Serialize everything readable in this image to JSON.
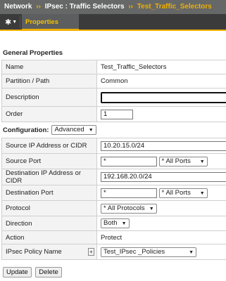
{
  "breadcrumb": {
    "items": [
      "Network",
      "IPsec : Traffic Selectors"
    ],
    "separator": "››",
    "current": "Test_Traffic_Selectors"
  },
  "tabs": {
    "gear_icon": "gear-icon",
    "properties": "Properties"
  },
  "general": {
    "title": "General Properties",
    "rows": {
      "name": {
        "label": "Name",
        "value": "Test_Traffic_Selectors"
      },
      "partition": {
        "label": "Partition / Path",
        "value": "Common"
      },
      "description": {
        "label": "Description",
        "value": ""
      },
      "order": {
        "label": "Order",
        "value": "1"
      }
    }
  },
  "configuration": {
    "title": "Configuration:",
    "mode": "Advanced",
    "rows": {
      "source_ip": {
        "label": "Source IP Address or CIDR",
        "value": "10.20.15.0/24"
      },
      "source_port": {
        "label": "Source Port",
        "value": "*",
        "select": "* All Ports"
      },
      "dest_ip": {
        "label": "Destination IP Address or CIDR",
        "value": "192.168.20.0/24"
      },
      "dest_port": {
        "label": "Destination Port",
        "value": "*",
        "select": "* All Ports"
      },
      "protocol": {
        "label": "Protocol",
        "select": "* All Protocols"
      },
      "direction": {
        "label": "Direction",
        "select": "Both"
      },
      "action": {
        "label": "Action",
        "value": "Protect"
      },
      "policy": {
        "label": "IPsec Policy Name",
        "plus": "+",
        "select": "Test_IPsec _Policies"
      }
    }
  },
  "buttons": {
    "update": "Update",
    "delete": "Delete"
  },
  "colors": {
    "accent": "#f0b000",
    "header_bg": "#666767",
    "tabbar_bg": "#3b3b3c"
  }
}
